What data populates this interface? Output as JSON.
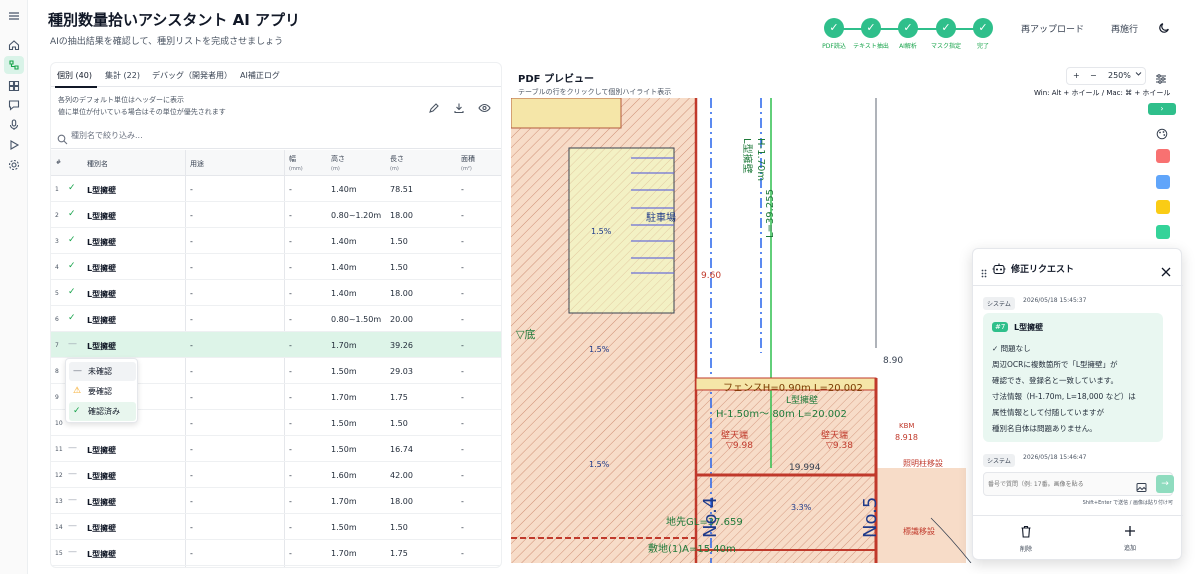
{
  "app": {
    "title": "種別数量拾いアシスタント AI アプリ",
    "subtitle": "AIの抽出結果を確認して、種別リストを完成させましょう"
  },
  "stepper": {
    "steps": [
      "PDF読込",
      "テキスト抽出",
      "AI解析",
      "マスク指定",
      "完了"
    ],
    "check": "✓"
  },
  "header_actions": {
    "reupload": "再アップロード",
    "rerun": "再施行"
  },
  "tabs": [
    "個別 (40)",
    "集計 (22)",
    "デバッグ（開発者用）",
    "AI補正ログ"
  ],
  "notes": {
    "line1": "各列のデフォルト単位はヘッダーに表示",
    "line2": "値に単位が付いている場合はその単位が優先されます"
  },
  "search": {
    "placeholder": "種別名で絞り込み..."
  },
  "table": {
    "headers": {
      "num": "#",
      "name": "種別名",
      "use": "用途",
      "width": "幅",
      "width_unit": "(mm)",
      "height": "高さ",
      "height_unit": "(m)",
      "length": "長さ",
      "length_unit": "(m)",
      "area": "面積",
      "area_unit": "(m²)"
    },
    "rows": [
      {
        "idx": "1",
        "status": "✓",
        "name": "L型擁壁",
        "use": "-",
        "width": "-",
        "height": "1.40m",
        "length": "78.51",
        "area": "-"
      },
      {
        "idx": "2",
        "status": "✓",
        "name": "L型擁壁",
        "use": "-",
        "width": "-",
        "height": "0.80~1.20m",
        "length": "18.00",
        "area": "-"
      },
      {
        "idx": "3",
        "status": "✓",
        "name": "L型擁壁",
        "use": "-",
        "width": "-",
        "height": "1.40m",
        "length": "1.50",
        "area": "-"
      },
      {
        "idx": "4",
        "status": "✓",
        "name": "L型擁壁",
        "use": "-",
        "width": "-",
        "height": "1.40m",
        "length": "1.50",
        "area": "-"
      },
      {
        "idx": "5",
        "status": "✓",
        "name": "L型擁壁",
        "use": "-",
        "width": "-",
        "height": "1.40m",
        "length": "18.00",
        "area": "-"
      },
      {
        "idx": "6",
        "status": "✓",
        "name": "L型擁壁",
        "use": "-",
        "width": "-",
        "height": "0.80~1.50m",
        "length": "20.00",
        "area": "-"
      },
      {
        "idx": "7",
        "status": "—",
        "name": "L型擁壁",
        "use": "-",
        "width": "-",
        "height": "1.70m",
        "length": "39.26",
        "area": "-"
      },
      {
        "idx": "8",
        "status": "",
        "name": "",
        "use": "-",
        "width": "-",
        "height": "1.50m",
        "length": "29.03",
        "area": "-"
      },
      {
        "idx": "9",
        "status": "",
        "name": "",
        "use": "-",
        "width": "-",
        "height": "1.70m",
        "length": "1.75",
        "area": "-"
      },
      {
        "idx": "10",
        "status": "",
        "name": "",
        "use": "-",
        "width": "-",
        "height": "1.50m",
        "length": "1.50",
        "area": "-"
      },
      {
        "idx": "11",
        "status": "—",
        "name": "L型擁壁",
        "use": "-",
        "width": "-",
        "height": "1.50m",
        "length": "16.74",
        "area": "-"
      },
      {
        "idx": "12",
        "status": "—",
        "name": "L型擁壁",
        "use": "-",
        "width": "-",
        "height": "1.60m",
        "length": "42.00",
        "area": "-"
      },
      {
        "idx": "13",
        "status": "—",
        "name": "L型擁壁",
        "use": "-",
        "width": "-",
        "height": "1.70m",
        "length": "18.00",
        "area": "-"
      },
      {
        "idx": "14",
        "status": "—",
        "name": "L型擁壁",
        "use": "-",
        "width": "-",
        "height": "1.50m",
        "length": "1.50",
        "area": "-"
      },
      {
        "idx": "15",
        "status": "—",
        "name": "L型擁壁",
        "use": "-",
        "width": "-",
        "height": "1.70m",
        "length": "1.75",
        "area": "-"
      }
    ]
  },
  "status_menu": {
    "items": [
      {
        "icon": "—",
        "label": "未確認"
      },
      {
        "icon": "⚠",
        "label": "要確認"
      },
      {
        "icon": "✓",
        "label": "確認済み"
      }
    ]
  },
  "pdf": {
    "title": "PDF プレビュー",
    "subtitle": "テーブルの行をクリックして個別ハイライト表示",
    "zoom": "250%",
    "zoom_in": "+",
    "zoom_out": "−",
    "hint": "Win: Alt + ホイール / Mac: ⌘ + ホイール",
    "labels": {
      "parking": "駐車場",
      "fence": "フェンスH=0.90m L=20.002",
      "wall_h": "H-1.50m～ 80m L=20.002",
      "wall_l": "L型擁壁",
      "heki1": "壁天端",
      "heki1v": "▽9.98",
      "heki2": "壁天端",
      "heki2v": "▽9.38",
      "lotline": "敷地(1)A=15.40m",
      "foot": "地先GL=37.659",
      "no4": "No.4",
      "no5": "No.5",
      "lm1": "L型擁壁",
      "lm2": "H-1.70m",
      "lm3": "L=39.255",
      "ground": "▽底",
      "pct1": "1.5%",
      "pct2": "1.5%",
      "pct3": "1.5%",
      "pct4": "3.3%",
      "pole": "照明柱移設",
      "sign": "標識移設",
      "val1": "9.60",
      "val2": "8.90",
      "val3": "19.994",
      "kbm": "KBM",
      "kbmv": "8.918"
    }
  },
  "palette": {
    "colors": [
      "#f87171",
      "#60a5fa",
      "#facc15",
      "#34d399"
    ]
  },
  "dialog": {
    "title": "修正リクエスト",
    "sys_label1": "システム",
    "time1": "2026/05/18 15:45:37",
    "ref_num": "#7",
    "ref_name": "L型擁壁",
    "lines": [
      "✓ 問題なし",
      "周辺OCRに複数箇所で「L型擁壁」が",
      "確認でき、登録名と一致しています。",
      "寸法情報（H-1.70m, L=18,000 など）は",
      "属性情報として付随していますが",
      "種別名自体は問題ありません。"
    ],
    "sys_label2": "システム",
    "time2": "2026/05/18 15:46:47",
    "input_placeholder": "番号で質問（例: 17番。画像を貼る",
    "send": "→",
    "hint": "Shift+Enter で送信 / 画像は貼り付け可",
    "delete_label": "削除",
    "add_label": "追加"
  }
}
